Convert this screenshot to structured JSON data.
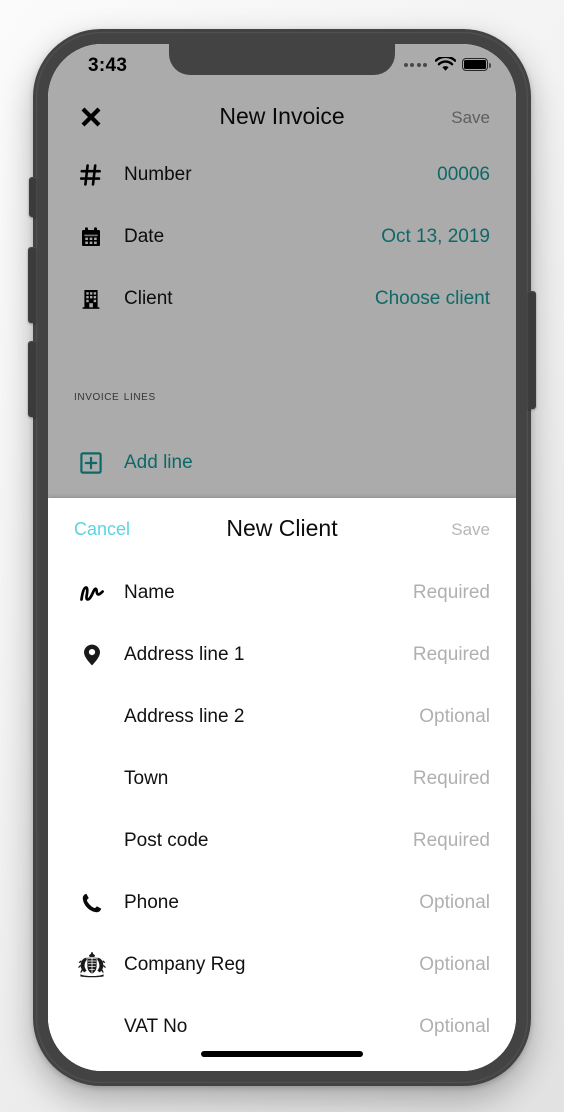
{
  "device": {
    "frame_color": "#434343",
    "accent_teal": "#169c9c",
    "accent_cyan": "#5cd4dc",
    "disabled_gray": "#b6b6b6"
  },
  "status_bar": {
    "time": "3:43",
    "signal_dots": 4,
    "wifi_icon": "wifi-icon",
    "battery_icon": "battery-full-icon"
  },
  "invoice_screen": {
    "close_icon": "close-x-icon",
    "title": "New Invoice",
    "save_label": "Save",
    "rows": [
      {
        "icon": "hash-icon",
        "label": "Number",
        "value": "00006"
      },
      {
        "icon": "calendar-icon",
        "label": "Date",
        "value": "Oct 13, 2019"
      },
      {
        "icon": "building-icon",
        "label": "Client",
        "value": "Choose client"
      }
    ],
    "section_title": "Invoice Lines",
    "add_line": {
      "icon": "plus-box-icon",
      "label": "Add line"
    }
  },
  "new_client_sheet": {
    "cancel_label": "Cancel",
    "title": "New Client",
    "save_label": "Save",
    "fields": [
      {
        "icon": "signature-icon",
        "label": "Name",
        "placeholder": "Required"
      },
      {
        "icon": "location-pin-icon",
        "label": "Address line 1",
        "placeholder": "Required"
      },
      {
        "icon": null,
        "label": "Address line 2",
        "placeholder": "Optional"
      },
      {
        "icon": null,
        "label": "Town",
        "placeholder": "Required"
      },
      {
        "icon": null,
        "label": "Post code",
        "placeholder": "Required"
      },
      {
        "icon": "phone-icon",
        "label": "Phone",
        "placeholder": "Optional"
      },
      {
        "icon": "coat-of-arms-icon",
        "label": "Company Reg",
        "placeholder": "Optional"
      },
      {
        "icon": null,
        "label": "VAT No",
        "placeholder": "Optional"
      }
    ]
  }
}
